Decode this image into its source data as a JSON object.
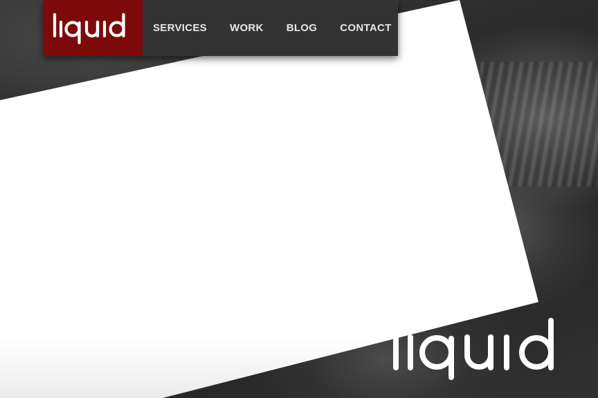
{
  "brand": {
    "logo_text": "liquid",
    "accent_color": "#7d0a0a"
  },
  "nav": {
    "items": [
      {
        "label": "SERVICES"
      },
      {
        "label": "WORK"
      },
      {
        "label": "BLOG"
      },
      {
        "label": "CONTACT"
      }
    ]
  },
  "footer_logo": {
    "text": "liquid",
    "color": "#ffffff"
  },
  "icons": {
    "header_logo": "liquid-logo-icon",
    "footer_logo": "liquid-wordmark-icon"
  }
}
